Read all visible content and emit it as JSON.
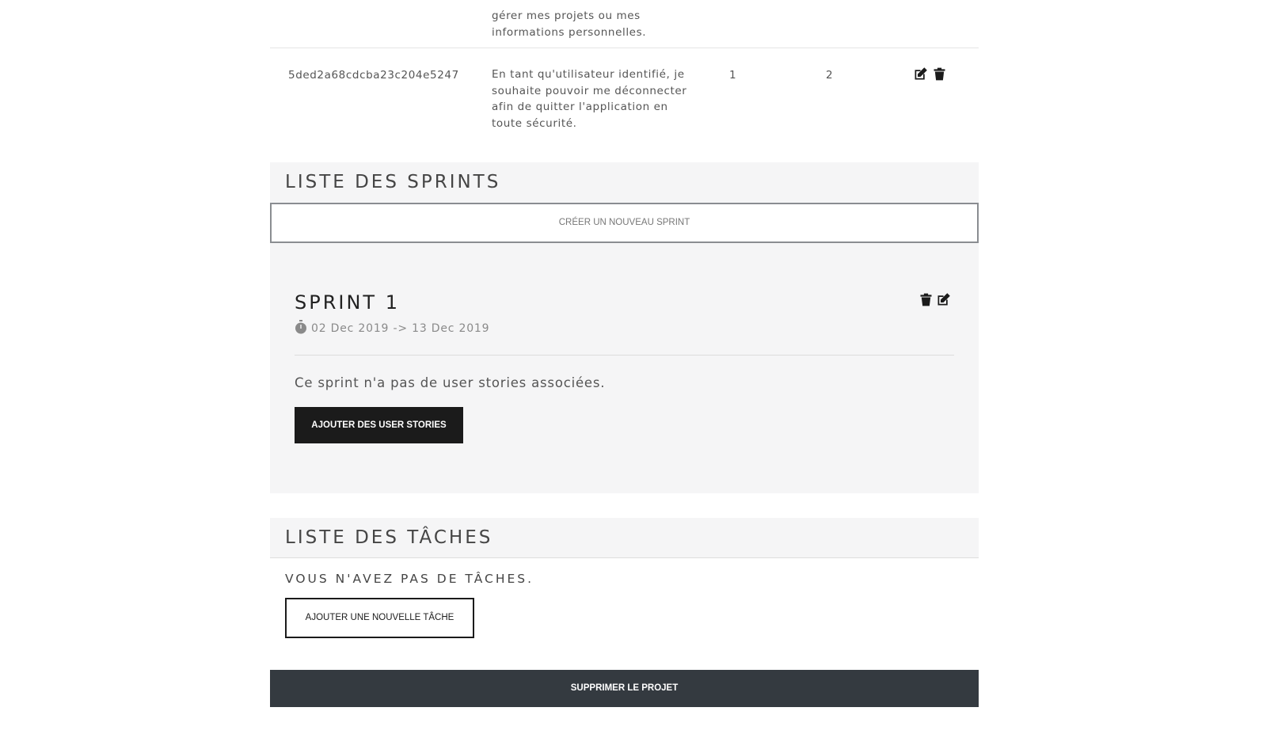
{
  "user_stories": {
    "rows": [
      {
        "id": "",
        "description": "gérer mes projets ou mes informations personnelles.",
        "v1": "",
        "v2": ""
      },
      {
        "id": "5ded2a68cdcba23c204e5247",
        "description": "En tant qu'utilisateur identifié, je souhaite pouvoir me déconnecter afin de quitter l'application en toute sécurité.",
        "v1": "1",
        "v2": "2"
      }
    ]
  },
  "sprints": {
    "header": "LISTE DES SPRINTS",
    "create_label": "CRÉER UN NOUVEAU SPRINT",
    "items": [
      {
        "title": "SPRINT 1",
        "dates": "02 Dec 2019 -> 13 Dec 2019",
        "empty_text": "Ce sprint n'a pas de user stories associées.",
        "add_label": "AJOUTER DES USER STORIES"
      }
    ]
  },
  "tasks": {
    "header": "LISTE DES TÂCHES",
    "empty_text": "VOUS N'AVEZ PAS DE TÂCHES.",
    "add_label": "AJOUTER UNE NOUVELLE TÂCHE"
  },
  "delete_project_label": "SUPPRIMER LE PROJET",
  "colors": {
    "panel": "#f5f5f6",
    "dark_button": "#1b1b1b",
    "danger_button": "#343a40"
  },
  "icons": [
    "edit-icon",
    "trash-icon",
    "stopwatch-icon"
  ]
}
